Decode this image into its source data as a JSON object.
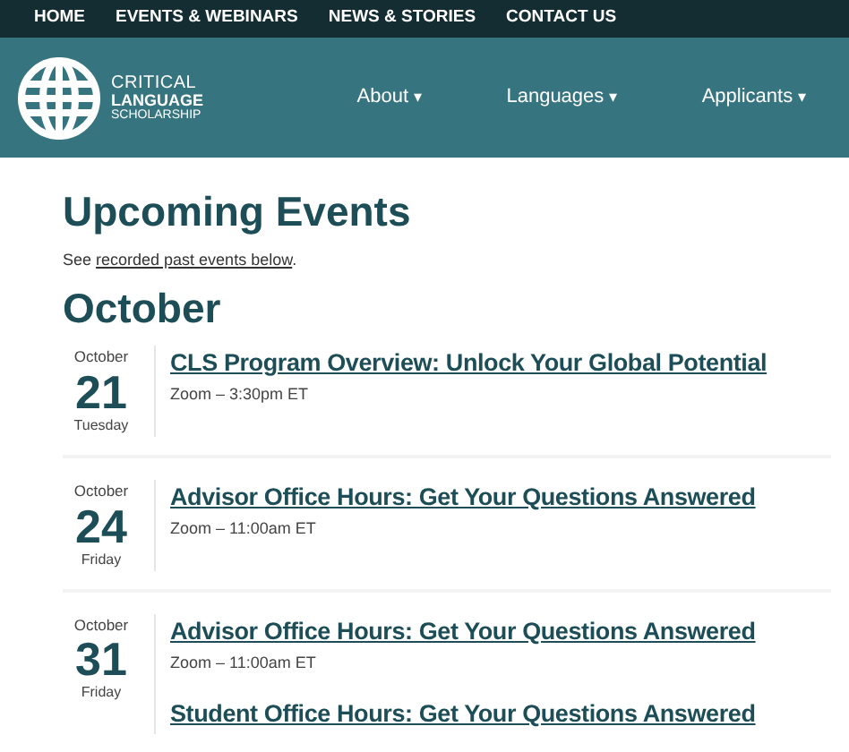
{
  "top_nav": [
    "HOME",
    "EVENTS & WEBINARS",
    "NEWS & STORIES",
    "CONTACT US"
  ],
  "logo": {
    "line_1": "CRITICAL",
    "line_2": "LANGUAGE",
    "line_3": "SCHOLARSHIP"
  },
  "main_nav": [
    {
      "label": "About",
      "caret": "▾"
    },
    {
      "label": "Languages",
      "caret": "▾"
    },
    {
      "label": "Applicants",
      "caret": "▾"
    }
  ],
  "heading": "Upcoming Events",
  "intro": {
    "before": "See ",
    "link": "recorded past events below",
    "after": "."
  },
  "month": "October",
  "days": [
    {
      "month": "October",
      "day": "21",
      "weekday": "Tuesday",
      "events": [
        {
          "title": "CLS Program Overview: Unlock Your Global Potential",
          "details": "Zoom – 3:30pm ET"
        }
      ]
    },
    {
      "month": "October",
      "day": "24",
      "weekday": "Friday",
      "events": [
        {
          "title": "Advisor Office Hours: Get Your Questions Answered",
          "details": "Zoom – 11:00am ET"
        }
      ]
    },
    {
      "month": "October",
      "day": "31",
      "weekday": "Friday",
      "events": [
        {
          "title": "Advisor Office Hours: Get Your Questions Answered",
          "details": "Zoom – 11:00am ET"
        },
        {
          "title": "Student Office Hours: Get Your Questions Answered"
        }
      ]
    }
  ]
}
